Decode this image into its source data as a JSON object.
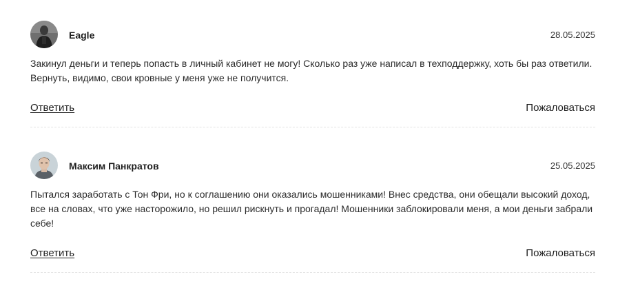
{
  "comments": [
    {
      "author": "Eagle",
      "date": "28.05.2025",
      "text": "Закинул деньги и теперь попасть в личный кабинет не могу! Сколько раз уже написал в техподдержку, хоть бы раз ответили. Вернуть, видимо, свои кровные у меня уже не получится.",
      "reply_label": "Ответить",
      "report_label": "Пожаловаться"
    },
    {
      "author": "Максим Панкратов",
      "date": "25.05.2025",
      "text": "Пытался заработать с Тон Фри, но к соглашению они оказались мошенниками! Внес средства, они обещали высокий доход, все на словах, что уже насторожило, но решил рискнуть и прогадал! Мошенники заблокировали меня, а мои деньги забрали себе!",
      "reply_label": "Ответить",
      "report_label": "Пожаловаться"
    }
  ]
}
